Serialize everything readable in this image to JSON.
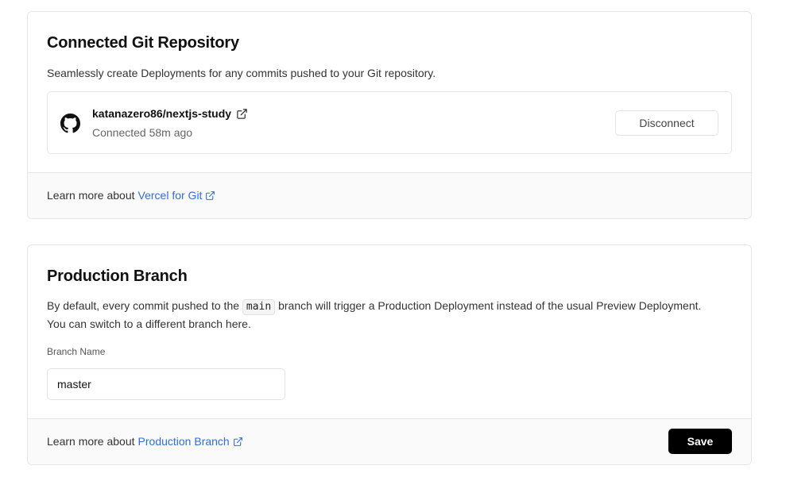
{
  "git": {
    "title": "Connected Git Repository",
    "description": "Seamlessly create Deployments for any commits pushed to your Git repository.",
    "repo": {
      "icon": "github-icon",
      "name": "katanazero86/nextjs-study",
      "status": "Connected 58m ago",
      "disconnect_label": "Disconnect"
    },
    "footer": {
      "prefix": "Learn more about",
      "link_label": "Vercel for Git"
    }
  },
  "production": {
    "title": "Production Branch",
    "description_before": "By default, every commit pushed to the",
    "description_code": "main",
    "description_after": "branch will trigger a Production Deployment instead of the usual Preview Deployment. You can switch to a different branch here.",
    "field_label": "Branch Name",
    "branch_value": "master",
    "footer": {
      "prefix": "Learn more about",
      "link_label": "Production Branch"
    },
    "save_label": "Save"
  },
  "colors": {
    "link": "#2f6fd6",
    "primary_button": "#000000",
    "footer_bg": "#fafafa",
    "border": "#e6e6e6"
  }
}
